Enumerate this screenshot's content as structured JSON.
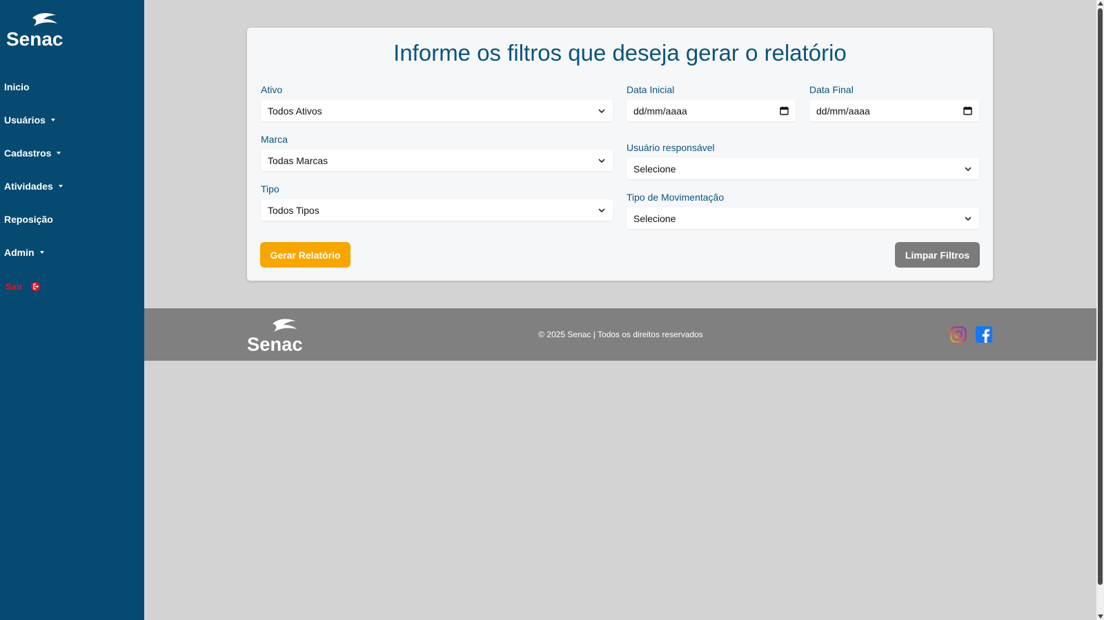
{
  "brand": {
    "logo_text": "Senac"
  },
  "sidebar": {
    "items": [
      {
        "label": "Inicio",
        "has_dropdown": false
      },
      {
        "label": "Usuários",
        "has_dropdown": true
      },
      {
        "label": "Cadastros",
        "has_dropdown": true
      },
      {
        "label": "Atividades",
        "has_dropdown": true
      },
      {
        "label": "Reposição",
        "has_dropdown": false
      },
      {
        "label": "Admin",
        "has_dropdown": true
      }
    ],
    "logout_label": "Sair"
  },
  "report": {
    "title": "Informe os filtros que deseja gerar o relatório",
    "ativo": {
      "label": "Ativo",
      "value": "Todos Ativos"
    },
    "marca": {
      "label": "Marca",
      "value": "Todas Marcas"
    },
    "tipo": {
      "label": "Tipo",
      "value": "Todos Tipos"
    },
    "data_inicial": {
      "label": "Data Inicial",
      "placeholder": "dd/mm/aaaa"
    },
    "data_final": {
      "label": "Data Final",
      "placeholder": "dd/mm/aaaa"
    },
    "usuario": {
      "label": "Usuário responsável",
      "value": "Selecione"
    },
    "movimentacao": {
      "label": "Tipo de Movimentação",
      "value": "Selecione"
    },
    "generate_button": "Gerar Relatório",
    "clear_button": "Limpar Filtros"
  },
  "footer": {
    "copyright": "© 2025 Senac | Todos os direitos reservados",
    "social_icons": [
      "instagram-icon",
      "facebook-icon"
    ]
  },
  "colors": {
    "sidebar_bg": "#064a72",
    "accent": "#f7a600",
    "title": "#0b5479",
    "logout": "#e0142b",
    "footer_bg": "#808080"
  }
}
